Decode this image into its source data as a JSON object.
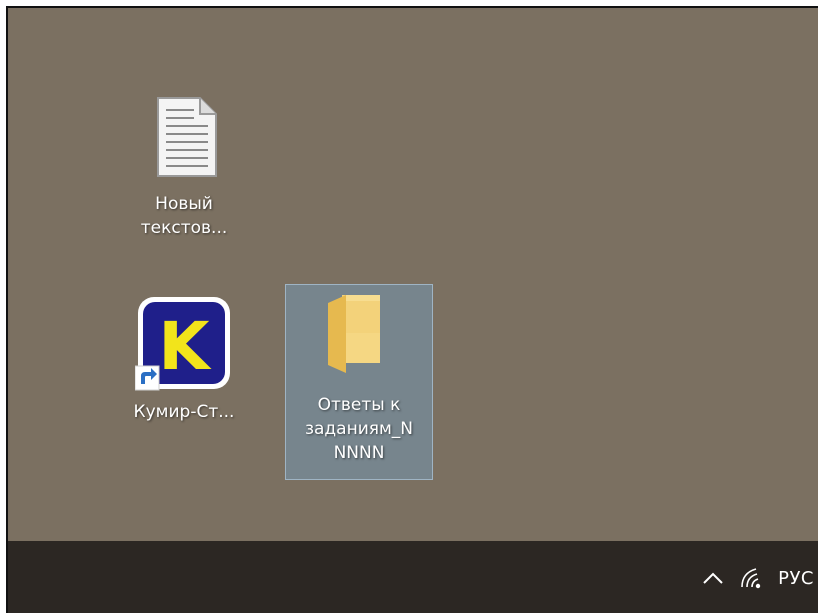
{
  "desktop": {
    "background": "#7b7061",
    "icons": [
      {
        "name": "text-document",
        "label": "Новый\nтекстов..."
      },
      {
        "name": "kumir-shortcut",
        "label": "Кумир-Ст...",
        "glyph": "K"
      },
      {
        "name": "answers-folder",
        "label": "Ответы к\nзаданиям_N\nNNNN",
        "selected": true
      }
    ]
  },
  "taskbar": {
    "background": "#2c2723",
    "tray": {
      "chevron_icon": "chevron-up-icon",
      "network_icon": "wifi-icon",
      "language": "РУС"
    }
  }
}
